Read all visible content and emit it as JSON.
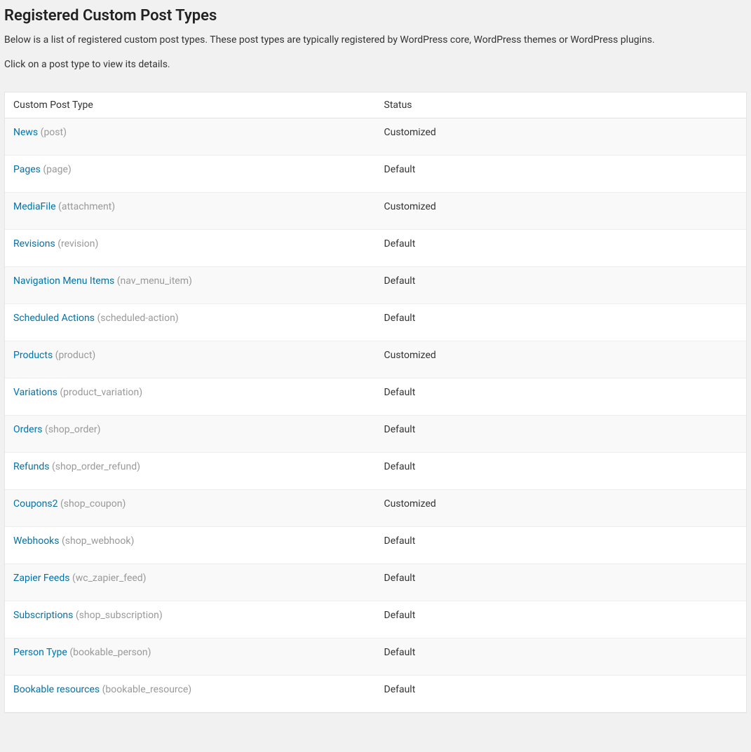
{
  "header": {
    "title": "Registered Custom Post Types",
    "description1": "Below is a list of registered custom post types. These post types are typically registered by WordPress core, WordPress themes or WordPress plugins.",
    "description2": "Click on a post type to view its details."
  },
  "table": {
    "columns": {
      "name": "Custom Post Type",
      "status": "Status"
    },
    "rows": [
      {
        "label": "News",
        "slug": "(post)",
        "status": "Customized"
      },
      {
        "label": "Pages",
        "slug": "(page)",
        "status": "Default"
      },
      {
        "label": "MediaFile",
        "slug": "(attachment)",
        "status": "Customized"
      },
      {
        "label": "Revisions",
        "slug": "(revision)",
        "status": "Default"
      },
      {
        "label": "Navigation Menu Items",
        "slug": "(nav_menu_item)",
        "status": "Default"
      },
      {
        "label": "Scheduled Actions",
        "slug": "(scheduled-action)",
        "status": "Default"
      },
      {
        "label": "Products",
        "slug": "(product)",
        "status": "Customized"
      },
      {
        "label": "Variations",
        "slug": "(product_variation)",
        "status": "Default"
      },
      {
        "label": "Orders",
        "slug": "(shop_order)",
        "status": "Default"
      },
      {
        "label": "Refunds",
        "slug": "(shop_order_refund)",
        "status": "Default"
      },
      {
        "label": "Coupons2",
        "slug": "(shop_coupon)",
        "status": "Customized"
      },
      {
        "label": "Webhooks",
        "slug": "(shop_webhook)",
        "status": "Default"
      },
      {
        "label": "Zapier Feeds",
        "slug": "(wc_zapier_feed)",
        "status": "Default"
      },
      {
        "label": "Subscriptions",
        "slug": "(shop_subscription)",
        "status": "Default"
      },
      {
        "label": "Person Type",
        "slug": "(bookable_person)",
        "status": "Default"
      },
      {
        "label": "Bookable resources",
        "slug": "(bookable_resource)",
        "status": "Default"
      }
    ]
  }
}
